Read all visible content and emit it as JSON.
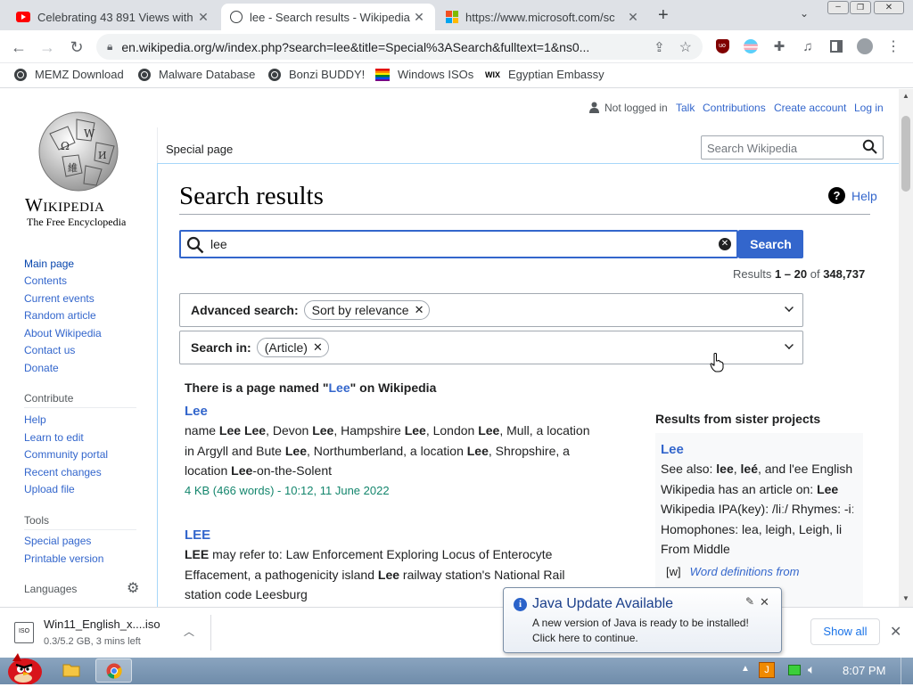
{
  "tabs": [
    {
      "title": "Celebrating 43 891 Views with",
      "favicon": "youtube-icon",
      "active": false
    },
    {
      "title": "lee - Search results - Wikipedia",
      "favicon": "globe-icon",
      "active": true
    },
    {
      "title": "https://www.microsoft.com/sc",
      "favicon": "microsoft-icon",
      "active": false
    }
  ],
  "toolbar": {
    "url": "en.wikipedia.org/w/index.php?search=lee&title=Special%3ASearch&fulltext=1&ns0..."
  },
  "bookmarks": [
    {
      "label": "MEMZ Download",
      "icon": "globe-icon"
    },
    {
      "label": "Malware Database",
      "icon": "globe-icon"
    },
    {
      "label": "Bonzi BUDDY!",
      "icon": "globe-icon"
    },
    {
      "label": "Windows ISOs",
      "icon": "rainbow-flag-icon"
    },
    {
      "label": "Egyptian Embassy",
      "icon": "wix-icon"
    }
  ],
  "wiki": {
    "logo_title": "Wikipedia",
    "logo_tagline": "The Free Encyclopedia",
    "nav_main": [
      "Main page",
      "Contents",
      "Current events",
      "Random article",
      "About Wikipedia",
      "Contact us",
      "Donate"
    ],
    "contribute_heading": "Contribute",
    "nav_contribute": [
      "Help",
      "Learn to edit",
      "Community portal",
      "Recent changes",
      "Upload file"
    ],
    "tools_heading": "Tools",
    "nav_tools": [
      "Special pages",
      "Printable version"
    ],
    "languages_heading": "Languages",
    "user_links": {
      "not_logged_in": "Not logged in",
      "talk": "Talk",
      "contributions": "Contributions",
      "create_account": "Create account",
      "log_in": "Log in"
    },
    "special_page_tab": "Special page",
    "search_placeholder": "Search Wikipedia",
    "page_title": "Search results",
    "help_label": "Help",
    "query": "lee",
    "search_button": "Search",
    "results_prefix": "Results ",
    "results_range": "1 – 20",
    "results_of": " of ",
    "results_total": "348,737",
    "advanced_label": "Advanced search:",
    "advanced_chip": "Sort by relevance",
    "search_in_label": "Search in:",
    "search_in_chip": "(Article)",
    "page_named_prefix": "There is a page named \"",
    "page_named_term": "Lee",
    "page_named_suffix": "\" on Wikipedia",
    "results": [
      {
        "title": "Lee",
        "snippet_html": "name <b>Lee</b> <b>Lee</b>, Devon <b>Lee</b>, Hampshire <b>Lee</b>, London <b>Lee</b>, Mull, a location in Argyll and Bute <b>Lee</b>, Northumberland, a location <b>Lee</b>, Shropshire, a location <b>Lee</b>-on-the-Solent",
        "meta": "4 KB (466 words) - 10:12, 11 June 2022"
      },
      {
        "title": "LEE",
        "snippet_html": "<b>LEE</b> may refer to: Law Enforcement Exploring Locus of Enterocyte Effacement, a pathogenicity island <b>Lee</b> railway station's National Rail station code Leesburg",
        "meta": ""
      }
    ],
    "sister_heading": "Results from sister projects",
    "sister_title": "Lee",
    "sister_snippet_html": "See also: <b>lee</b>, <b>leé</b>, and l'ee English Wikipedia has an article on: <b>Lee</b> Wikipedia IPA(key): /liː/ Rhymes: -iː Homophones: lea, leigh, Leigh, li From Middle",
    "sister_project_icon": "[w]",
    "sister_project_label": "Word definitions from"
  },
  "download": {
    "filename": "Win11_English_x....iso",
    "status": "0.3/5.2 GB, 3 mins left",
    "show_all": "Show all"
  },
  "java_popup": {
    "title": "Java Update Available",
    "line1": "A new version of Java is ready to be installed!",
    "line2": "Click here to continue."
  },
  "taskbar": {
    "clock": "8:07 PM"
  },
  "colors": {
    "link": "#3366cc",
    "primary_button": "#3366cc",
    "result_meta": "#14866d"
  }
}
